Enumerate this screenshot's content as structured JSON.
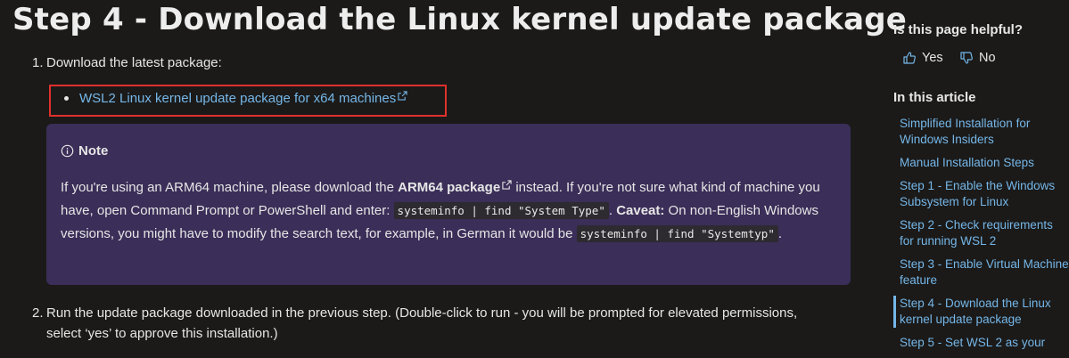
{
  "main": {
    "title": "Step 4 - Download the Linux kernel update package",
    "step1": {
      "number": "1.",
      "text": "Download the latest package:"
    },
    "download_link": "WSL2 Linux kernel update package for x64 machines",
    "note": {
      "heading": "Note",
      "text_1": "If you're using an ARM64 machine, please download the ",
      "arm_link": "ARM64 package",
      "text_2": " instead. If you're not sure what kind of machine you have, open Command Prompt or PowerShell and enter: ",
      "code_1": "systeminfo | find \"System Type\"",
      "text_3": ". ",
      "caveat_label": "Caveat:",
      "text_4": " On non-English Windows versions, you might have to modify the search text, for example, in German it would be ",
      "code_2": "systeminfo | find \"Systemtyp\"",
      "text_5": "."
    },
    "step2": {
      "number": "2.",
      "line1": "Run the update package downloaded in the previous step. (Double-click to run - you will be prompted for elevated permissions,",
      "line2": "select ‘yes’ to approve this installation.)"
    }
  },
  "aside": {
    "helpful_heading": "Is this page helpful?",
    "yes_label": "Yes",
    "no_label": "No",
    "toc_heading": "In this article",
    "toc_items": [
      "Simplified Installation for Windows Insiders",
      "Manual Installation Steps",
      "Step 1 - Enable the Windows Subsystem for Linux",
      "Step 2 - Check requirements for running WSL 2",
      "Step 3 - Enable Virtual Machine feature",
      "Step 4 - Download the Linux kernel update package",
      "Step 5 - Set WSL 2 as your"
    ],
    "active_index": 5
  },
  "colors": {
    "background": "#1b1a19",
    "link": "#75b6e7",
    "note_background": "#3b2e58",
    "highlight_border": "#e0302b"
  },
  "icons": [
    "external-link-icon",
    "info-icon",
    "thumbs-up-icon",
    "thumbs-down-icon"
  ]
}
